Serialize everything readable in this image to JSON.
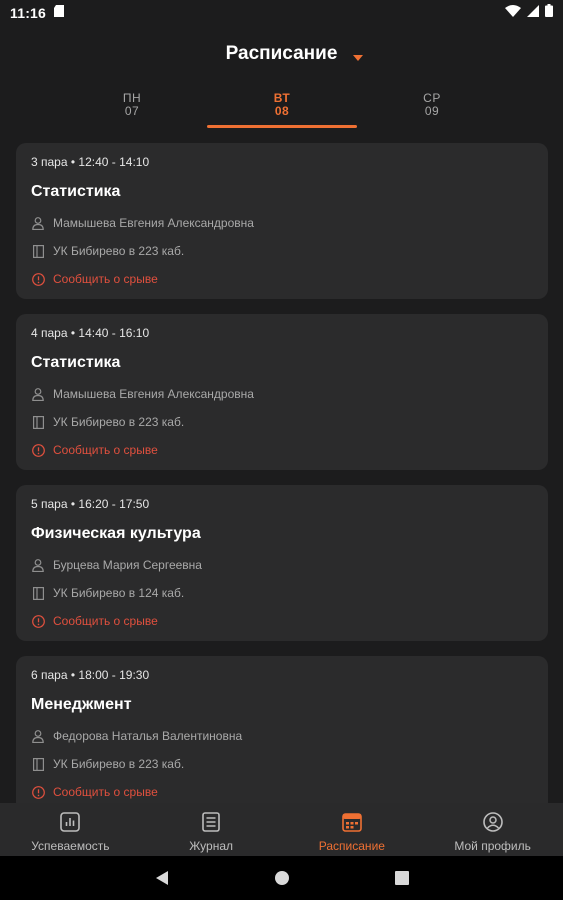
{
  "status_bar": {
    "time": "11:16",
    "icons": [
      "sd-card-icon",
      "wifi-icon",
      "signal-icon",
      "battery-icon"
    ]
  },
  "header": {
    "title": "Расписание",
    "dropdown_icon": "caret-down-icon"
  },
  "day_tabs": [
    {
      "name": "ПН",
      "number": "07",
      "active": false
    },
    {
      "name": "ВТ",
      "number": "08",
      "active": true
    },
    {
      "name": "СР",
      "number": "09",
      "active": false
    }
  ],
  "lessons": [
    {
      "time": "3 пара • 12:40 - 14:10",
      "subject": "Статистика",
      "teacher": "Мамышева Евгения Александровна",
      "location": "УК Бибирево в 223 каб.",
      "report_label": "Сообщить о срыве"
    },
    {
      "time": "4 пара • 14:40 - 16:10",
      "subject": "Статистика",
      "teacher": "Мамышева Евгения Александровна",
      "location": "УК Бибирево в 223 каб.",
      "report_label": "Сообщить о срыве"
    },
    {
      "time": "5 пара • 16:20 - 17:50",
      "subject": "Физическая культура",
      "teacher": "Бурцева Мария Сергеевна",
      "location": "УК Бибирево в 124 каб.",
      "report_label": "Сообщить о срыве"
    },
    {
      "time": "6 пара • 18:00 - 19:30",
      "subject": "Менеджмент",
      "teacher": "Федорова Наталья Валентиновна",
      "location": "УК Бибирево в 223 каб.",
      "report_label": "Сообщить о срыве"
    }
  ],
  "bottom_nav": [
    {
      "label": "Успеваемость",
      "icon": "chart-icon",
      "active": false
    },
    {
      "label": "Журнал",
      "icon": "journal-icon",
      "active": false
    },
    {
      "label": "Расписание",
      "icon": "calendar-icon",
      "active": true
    },
    {
      "label": "Мой профиль",
      "icon": "profile-icon",
      "active": false
    }
  ],
  "colors": {
    "background": "#1c1c1d",
    "card": "#2b2b2c",
    "accent": "#ef7033",
    "report": "#e0503e",
    "nav_bar": "#2a2a2b"
  },
  "system_nav": [
    "back-icon",
    "home-icon",
    "recents-icon"
  ]
}
